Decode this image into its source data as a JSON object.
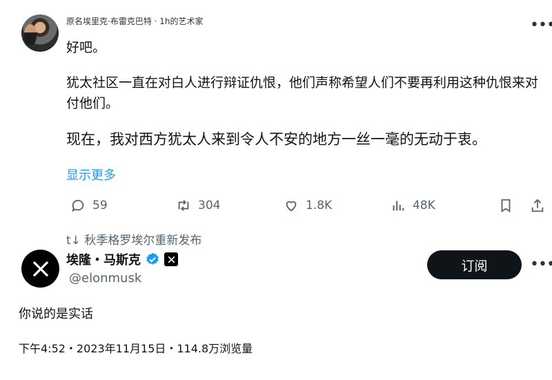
{
  "quoted_post": {
    "header": "原名埃里克·布雷克巴特 · 1h的艺术家",
    "paragraph1": "好吧。",
    "paragraph2": "犹太社区一直在对白人进行辩证仇恨，他们声称希望人们不要再利用这种仇恨来对付他们。",
    "paragraph3": "现在，我对西方犹太人来到令人不安的地方一丝一毫的无动于衷。",
    "show_more": "显示更多",
    "actions": {
      "replies": "59",
      "reposts": "304",
      "likes": "1.8K",
      "views": "48K"
    },
    "icons": [
      "reply-icon",
      "repost-icon",
      "like-icon",
      "views-icon",
      "bookmark-icon",
      "share-icon"
    ]
  },
  "repost_notice": "t↓ 秋季格罗埃尔重新发布",
  "main_post": {
    "display_name": "埃隆・马斯克",
    "handle": "@elonmusk",
    "follow_label": "订阅",
    "text": "你说的是实话",
    "meta": "下午4:52・2023年11月15日・114.8万浏览量"
  },
  "colors": {
    "accent": "#1d9bf0",
    "secondary_text": "#536471",
    "primary_text": "#0f1419"
  }
}
